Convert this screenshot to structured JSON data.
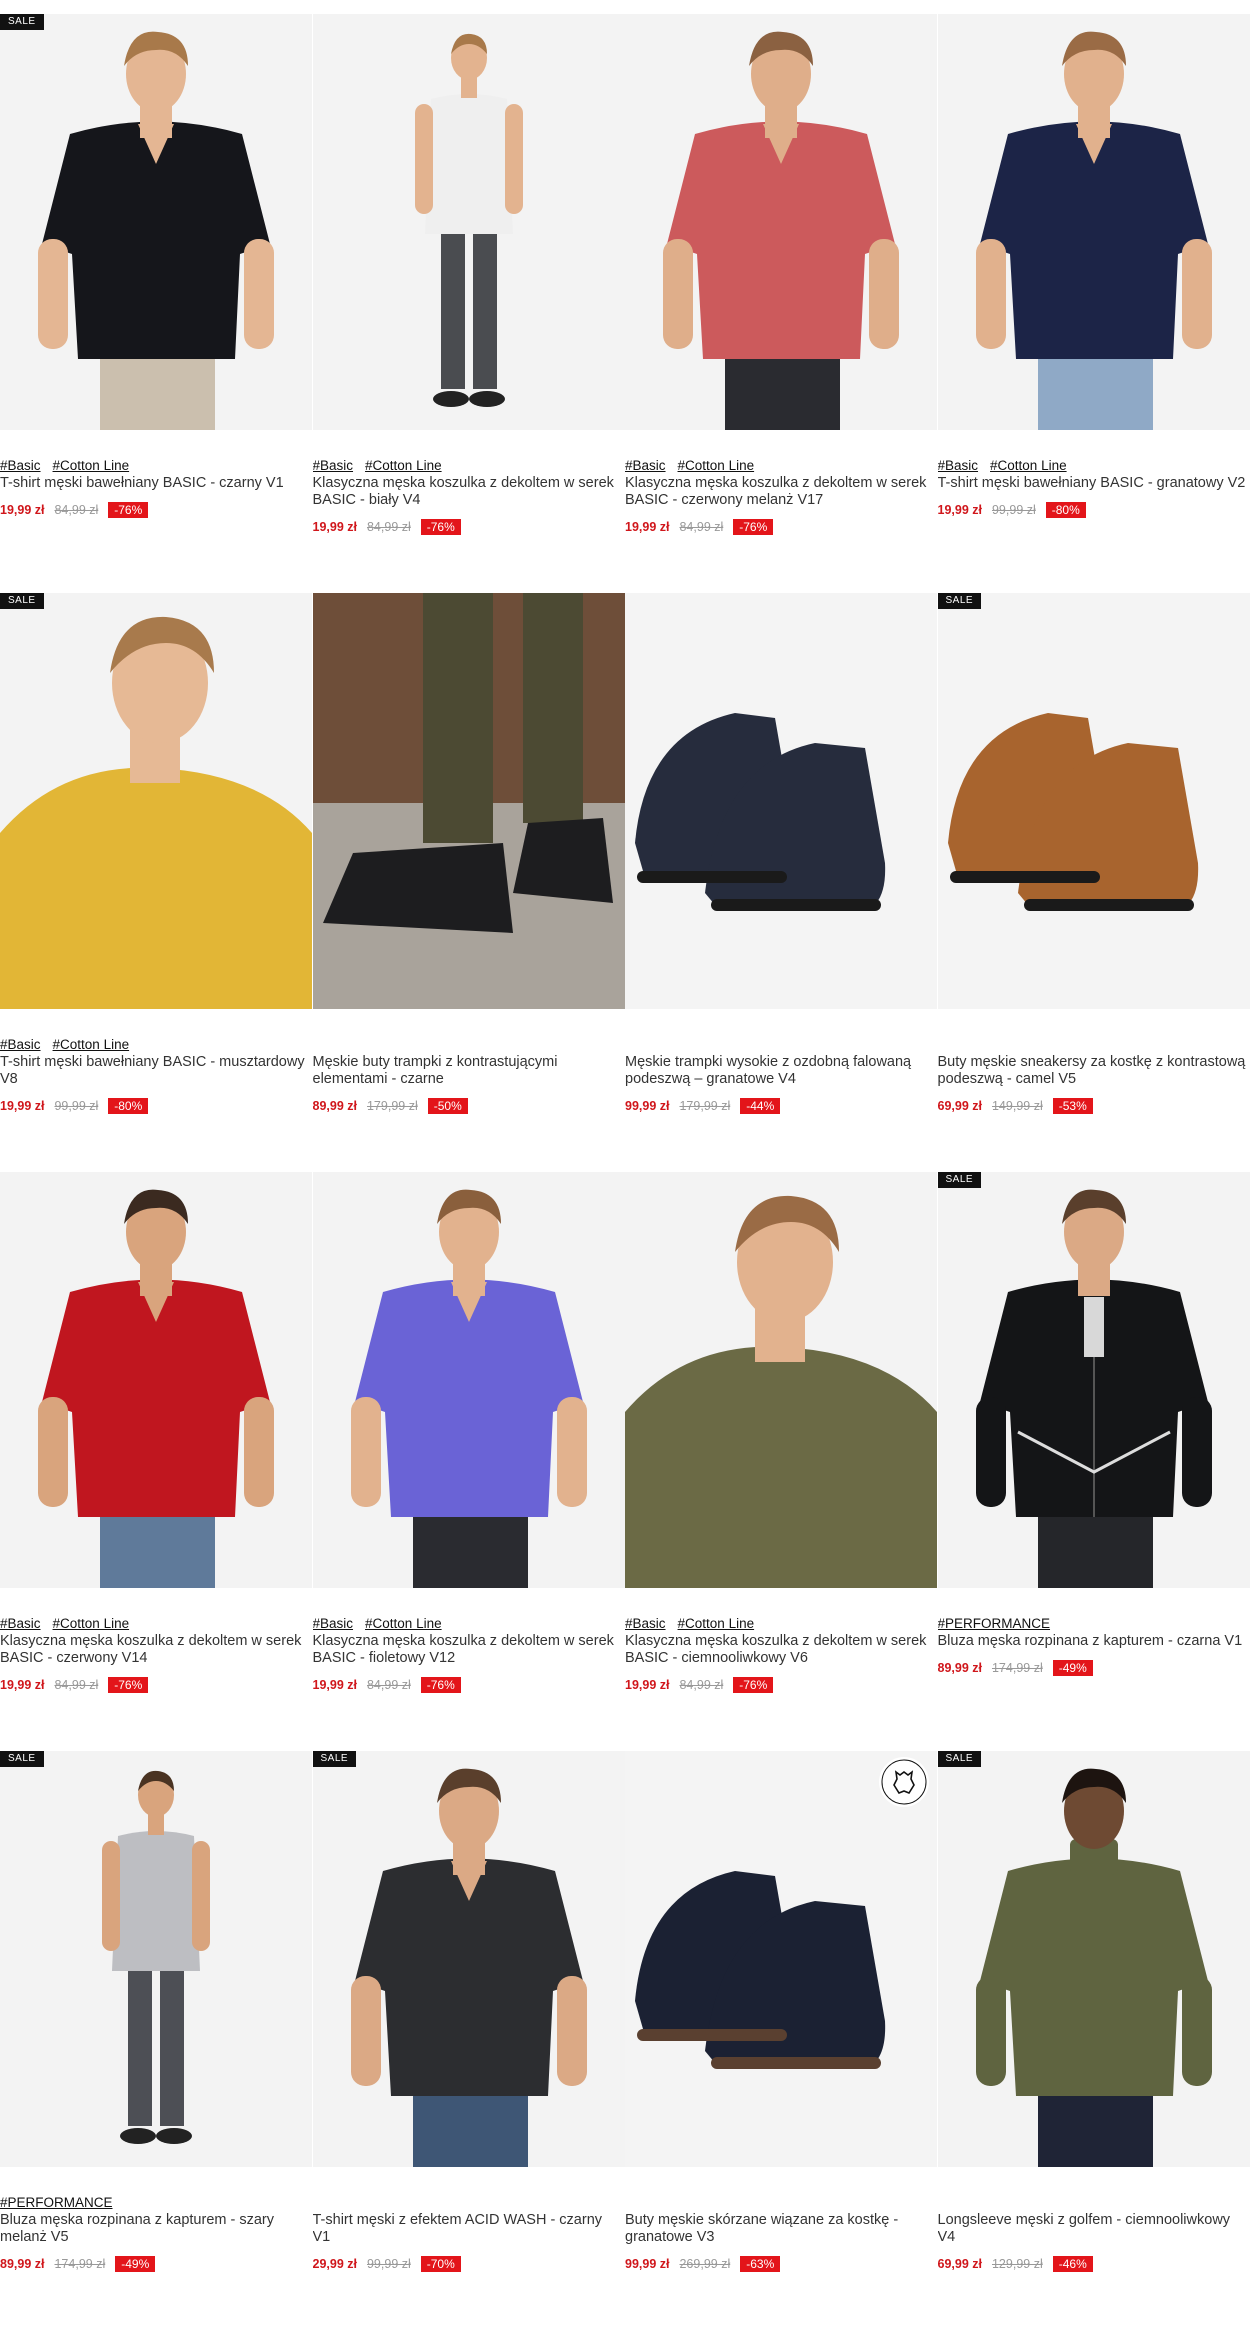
{
  "colors": {
    "sale_badge": "#111111",
    "price": "#d0161b",
    "discount_badge": "#e3151a",
    "old_price": "#999999"
  },
  "products": [
    {
      "sale": "SALE",
      "tags": [
        "#Basic",
        "#Cotton Line"
      ],
      "title": "T-shirt męski bawełniany BASIC - czarny V1",
      "price": "19,99 zł",
      "old_price": "84,99 zł",
      "discount": "-76%",
      "bg": "#f3f3f3",
      "item": "#15161b",
      "kind": "tee",
      "skin": "#e4b693",
      "hair": "#a8794a",
      "pants": "#cbbfae"
    },
    {
      "sale": "",
      "tags": [
        "#Basic",
        "#Cotton Line"
      ],
      "title": "Klasyczna męska koszulka z dekoltem w serek BASIC - biały V4",
      "price": "19,99 zł",
      "old_price": "84,99 zł",
      "discount": "-76%",
      "bg": "#f3f3f3",
      "item": "#efefef",
      "kind": "full",
      "skin": "#e3b38f",
      "hair": "#a8794a",
      "pants": "#4a4c50"
    },
    {
      "sale": "",
      "tags": [
        "#Basic",
        "#Cotton Line"
      ],
      "title": "Klasyczna męska koszulka z dekoltem w serek BASIC - czerwony melanż V17",
      "price": "19,99 zł",
      "old_price": "84,99 zł",
      "discount": "-76%",
      "bg": "#f3f3f3",
      "item": "#cc5a5c",
      "kind": "tee",
      "skin": "#dfae8a",
      "hair": "#8b6141",
      "pants": "#2a2b30"
    },
    {
      "sale": "",
      "tags": [
        "#Basic",
        "#Cotton Line"
      ],
      "title": "T-shirt męski bawełniany BASIC - granatowy V2",
      "price": "19,99 zł",
      "old_price": "99,99 zł",
      "discount": "-80%",
      "bg": "#f3f3f3",
      "item": "#1c2447",
      "kind": "tee",
      "skin": "#e1b18d",
      "hair": "#9a6b45",
      "pants": "#8fa9c6"
    },
    {
      "sale": "SALE",
      "tags": [
        "#Basic",
        "#Cotton Line"
      ],
      "title": "T-shirt męski bawełniany BASIC - musztardowy V8",
      "price": "19,99 zł",
      "old_price": "99,99 zł",
      "discount": "-80%",
      "bg": "#f3f3f3",
      "item": "#e2b636",
      "kind": "close",
      "skin": "#e6b995",
      "hair": "#a87a4c",
      "pants": "#e2b636"
    },
    {
      "sale": "",
      "tags": [],
      "title": "Męskie buty trampki z kontrastującymi elementami - czarne",
      "price": "89,99 zł",
      "old_price": "179,99 zł",
      "discount": "-50%",
      "bg": "#7a5a45",
      "item": "#1d1d1f",
      "kind": "legs",
      "skin": "",
      "hair": "",
      "pants": "#4c4a33"
    },
    {
      "sale": "",
      "tags": [],
      "title": "Męskie trampki wysokie z ozdobną falowaną podeszwą – granatowe V4",
      "price": "99,99 zł",
      "old_price": "179,99 zł",
      "discount": "-44%",
      "bg": "#f4f4f4",
      "item": "#262c3d",
      "kind": "shoes",
      "skin": "",
      "hair": "",
      "pants": ""
    },
    {
      "sale": "SALE",
      "tags": [],
      "title": "Buty męskie sneakersy za kostkę z kontrastową podeszwą - camel V5",
      "price": "69,99 zł",
      "old_price": "149,99 zł",
      "discount": "-53%",
      "bg": "#f4f4f4",
      "item": "#a8642e",
      "kind": "shoes",
      "skin": "",
      "hair": "",
      "pants": ""
    },
    {
      "sale": "",
      "tags": [
        "#Basic",
        "#Cotton Line"
      ],
      "title": "Klasyczna męska koszulka z dekoltem w serek BASIC - czerwony V14",
      "price": "19,99 zł",
      "old_price": "84,99 zł",
      "discount": "-76%",
      "bg": "#f3f3f3",
      "item": "#c0161f",
      "kind": "tee",
      "skin": "#d9a47d",
      "hair": "#3b2a20",
      "pants": "#5f7a9a"
    },
    {
      "sale": "",
      "tags": [
        "#Basic",
        "#Cotton Line"
      ],
      "title": "Klasyczna męska koszulka z dekoltem w serek BASIC - fioletowy V12",
      "price": "19,99 zł",
      "old_price": "84,99 zł",
      "discount": "-76%",
      "bg": "#f3f3f3",
      "item": "#6a63d6",
      "kind": "tee",
      "skin": "#e2b28e",
      "hair": "#8a5f3c",
      "pants": "#2a2b30"
    },
    {
      "sale": "",
      "tags": [
        "#Basic",
        "#Cotton Line"
      ],
      "title": "Klasyczna męska koszulka z dekoltem w serek BASIC - ciemnooliwkowy V6",
      "price": "19,99 zł",
      "old_price": "84,99 zł",
      "discount": "-76%",
      "bg": "#f3f3f3",
      "item": "#6b6a45",
      "kind": "close",
      "skin": "#e2b28e",
      "hair": "#9a6b45",
      "pants": "#6b6a45"
    },
    {
      "sale": "SALE",
      "tags": [
        "#PERFORMANCE"
      ],
      "title": "Bluza męska rozpinana z kapturem - czarna V1",
      "price": "89,99 zł",
      "old_price": "174,99 zł",
      "discount": "-49%",
      "bg": "#f3f3f3",
      "item": "#141517",
      "kind": "hoodie",
      "skin": "#dba985",
      "hair": "#5a3f2c",
      "pants": "#25262a"
    },
    {
      "sale": "SALE",
      "tags": [
        "#PERFORMANCE"
      ],
      "title": "Bluza męska rozpinana z kapturem - szary melanż V5",
      "price": "89,99 zł",
      "old_price": "174,99 zł",
      "discount": "-49%",
      "bg": "#f3f3f3",
      "item": "#bdbec2",
      "kind": "full",
      "skin": "#d9a47d",
      "hair": "#4a3322",
      "pants": "#4d4f55"
    },
    {
      "sale": "SALE",
      "tags": [],
      "title": "T-shirt męski z efektem ACID WASH - czarny V1",
      "price": "29,99 zł",
      "old_price": "99,99 zł",
      "discount": "-70%",
      "bg": "#f3f3f3",
      "item": "#2c2d30",
      "kind": "tee",
      "skin": "#dba985",
      "hair": "#5a3f2c",
      "pants": "#3e5675"
    },
    {
      "sale": "",
      "tags": [],
      "title": "Buty męskie skórzane wiązane za kostkę - granatowe V3",
      "price": "99,99 zł",
      "old_price": "269,99 zł",
      "discount": "-63%",
      "bg": "#f4f4f4",
      "item": "#1b2133",
      "kind": "boots",
      "skin": "",
      "hair": "",
      "pants": "",
      "leather_badge": true
    },
    {
      "sale": "SALE",
      "tags": [],
      "title": "Longsleeve męski z golfem - ciemnooliwkowy V4",
      "price": "69,99 zł",
      "old_price": "129,99 zł",
      "discount": "-46%",
      "bg": "#f3f3f3",
      "item": "#5f6440",
      "kind": "turtle",
      "skin": "#6e4a33",
      "hair": "#1d1410",
      "pants": "#1f2436"
    }
  ]
}
